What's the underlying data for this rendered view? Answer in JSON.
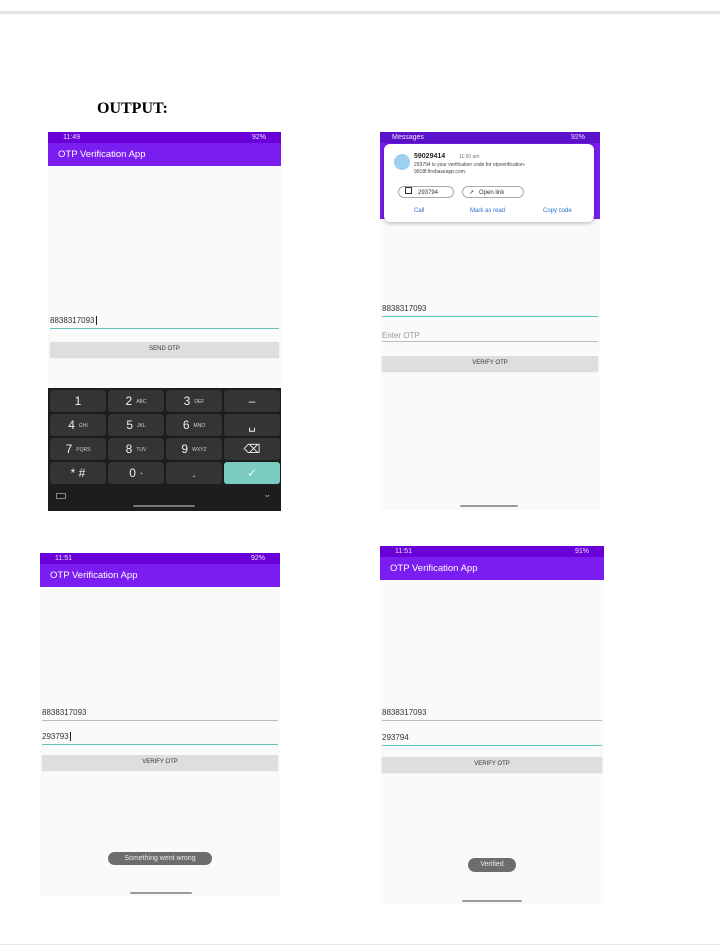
{
  "document": {
    "heading": "OUTPUT:"
  },
  "colors": {
    "status_bar": "#6a00d8",
    "app_bar": "#7a1df0",
    "accent": "#5ec5b8"
  },
  "screen1": {
    "status_time": "11:49",
    "status_right": "92%",
    "app_title": "OTP Verification App",
    "phone_value": "8838317093",
    "send_button": "SEND OTP",
    "keyboard": {
      "rows": [
        [
          {
            "main": "1",
            "sub": ""
          },
          {
            "main": "2",
            "sub": "ABC"
          },
          {
            "main": "3",
            "sub": "DEF"
          },
          {
            "main": "–",
            "sub": ""
          }
        ],
        [
          {
            "main": "4",
            "sub": "GHI"
          },
          {
            "main": "5",
            "sub": "JKL"
          },
          {
            "main": "6",
            "sub": "MNO"
          },
          {
            "main": "␣",
            "sub": ""
          }
        ],
        [
          {
            "main": "7",
            "sub": "PQRS"
          },
          {
            "main": "8",
            "sub": "TUV"
          },
          {
            "main": "9",
            "sub": "WXYZ"
          },
          {
            "main": "⌫",
            "sub": ""
          }
        ],
        [
          {
            "main": "* #",
            "sub": ""
          },
          {
            "main": "0",
            "sub": "+"
          },
          {
            "main": ".",
            "sub": ""
          },
          {
            "main": "✓",
            "sub": ""
          }
        ]
      ],
      "keyboard_icon": "keyboard-icon",
      "hide_icon": "chevron-down-icon"
    }
  },
  "screen2": {
    "notif_app": "Messages",
    "status_right": "92%",
    "sender": "59029414",
    "time": "11:50 am",
    "message": "293794 is your verification code for otpverification-9918f.firebaseapp.com.",
    "copy_chip": "293794",
    "link_chip": "Open link",
    "actions": {
      "call": "Call",
      "mark": "Mark as read",
      "copy": "Copy code"
    },
    "phone_value": "8838317093",
    "otp_placeholder": "Enter OTP",
    "verify_button": "VERIFY OTP"
  },
  "screen3": {
    "status_time": "11:51",
    "status_right": "92%",
    "app_title": "OTP Verification App",
    "phone_value": "8838317093",
    "otp_value": "293793",
    "verify_button": "VERIFY OTP",
    "toast": "Something went wrong"
  },
  "screen4": {
    "status_time": "11:51",
    "status_right": "91%",
    "app_title": "OTP Verification App",
    "phone_value": "8838317093",
    "otp_value": "293794",
    "verify_button": "VERIFY OTP",
    "toast": "Verified"
  }
}
